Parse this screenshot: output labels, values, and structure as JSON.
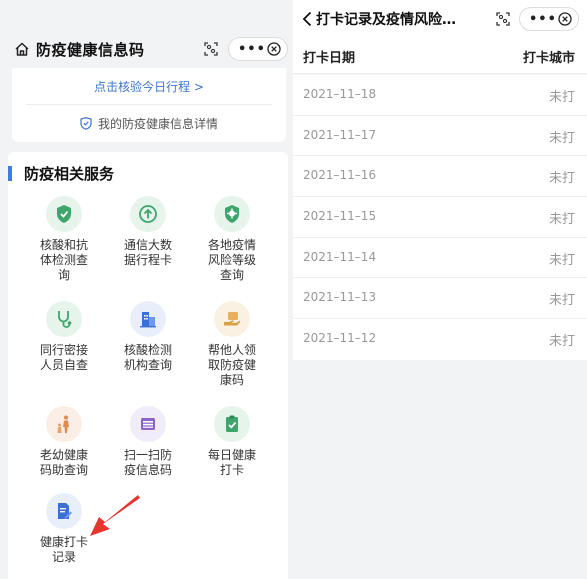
{
  "left": {
    "title": "防疫健康信息码",
    "verify_link": "点击核验今日行程 >",
    "detail_link": "我的防疫健康信息详情",
    "section_title": "防疫相关服务",
    "services": [
      {
        "label": "核酸和抗体检测查询",
        "icon": "shield-test-icon",
        "bg": "#e6f4ec",
        "fg": "#3fa66b"
      },
      {
        "label": "通信大数据行程卡",
        "icon": "arrow-up-circle-icon",
        "bg": "#e6f4ec",
        "fg": "#3fa66b"
      },
      {
        "label": "各地疫情风险等级查询",
        "icon": "virus-shield-icon",
        "bg": "#e6f4ec",
        "fg": "#3fa66b"
      },
      {
        "label": "同行密接人员自查",
        "icon": "stethoscope-icon",
        "bg": "#e6f4ec",
        "fg": "#3fa66b"
      },
      {
        "label": "核酸检测机构查询",
        "icon": "building-icon",
        "bg": "#e8eefa",
        "fg": "#3a6fd6"
      },
      {
        "label": "帮他人领取防疫健康码",
        "icon": "hand-card-icon",
        "bg": "#fbf1e2",
        "fg": "#d9a047"
      },
      {
        "label": "老幼健康码助查询",
        "icon": "elderly-child-icon",
        "bg": "#fbeee6",
        "fg": "#e08a4d"
      },
      {
        "label": "扫一扫防疫信息码",
        "icon": "scan-frame-icon",
        "bg": "#f1ecfa",
        "fg": "#8b63c9"
      },
      {
        "label": "每日健康打卡",
        "icon": "clipboard-check-icon",
        "bg": "#e6f4ec",
        "fg": "#3fa66b"
      },
      {
        "label": "健康打卡记录",
        "icon": "document-edit-icon",
        "bg": "#e8eefa",
        "fg": "#3a6fd6"
      }
    ]
  },
  "right": {
    "title": "打卡记录及疫情风险…",
    "col_date": "打卡日期",
    "col_city": "打卡城市",
    "rows": [
      {
        "date": "2021–11–18",
        "status": "未打"
      },
      {
        "date": "2021–11–17",
        "status": "未打"
      },
      {
        "date": "2021–11–16",
        "status": "未打"
      },
      {
        "date": "2021–11–15",
        "status": "未打"
      },
      {
        "date": "2021–11–14",
        "status": "未打"
      },
      {
        "date": "2021–11–13",
        "status": "未打"
      },
      {
        "date": "2021–11–12",
        "status": "未打"
      }
    ]
  },
  "colors": {
    "accent": "#3b7de0",
    "link": "#3c76c9",
    "arrow": "#e8362e"
  }
}
